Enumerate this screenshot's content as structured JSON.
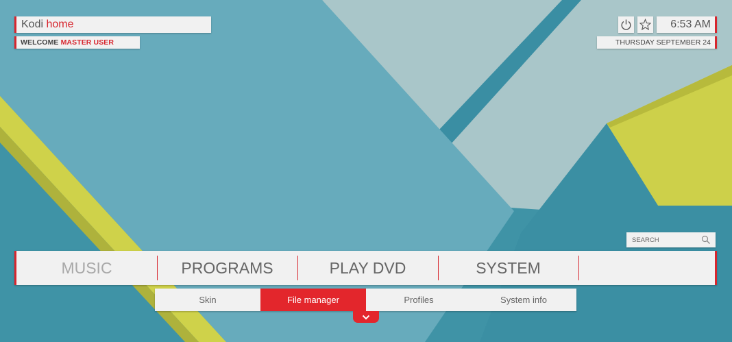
{
  "header": {
    "app_name": "Kodi",
    "page_name": "home",
    "welcome_prefix": "WELCOME",
    "user_name": "MASTER USER",
    "time": "6:53 AM",
    "date": "THURSDAY SEPTEMBER 24"
  },
  "top_icons": [
    "power-icon",
    "star-icon"
  ],
  "search": {
    "label": "SEARCH",
    "icon": "search-icon"
  },
  "main_menu": {
    "items": [
      {
        "label": "MUSIC"
      },
      {
        "label": "PROGRAMS"
      },
      {
        "label": "PLAY DVD"
      },
      {
        "label": "SYSTEM"
      }
    ]
  },
  "sub_menu": {
    "items": [
      {
        "label": "Skin"
      },
      {
        "label": "File manager"
      },
      {
        "label": "Profiles"
      },
      {
        "label": "System info"
      }
    ],
    "active": "File manager"
  },
  "expand_icon": "chevron-down-icon",
  "colors": {
    "accent": "#e3262c",
    "panel": "#f1f1f1",
    "teal": "#3f93a6",
    "light_teal": "#6cb1c1",
    "pale_blue": "#aac8cb",
    "yellow": "#cfd24a"
  }
}
